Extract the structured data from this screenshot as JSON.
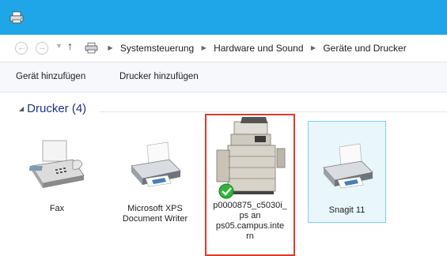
{
  "window": {
    "title_icon": "devices-printers-icon",
    "accent": "#1fa6e8"
  },
  "address": {
    "breadcrumb": [
      "Systemsteuerung",
      "Hardware und Sound",
      "Geräte und Drucker"
    ]
  },
  "commands": {
    "add_device": "Gerät hinzufügen",
    "add_printer": "Drucker hinzufügen"
  },
  "group": {
    "label": "Drucker (4)"
  },
  "printers": [
    {
      "label": "Fax"
    },
    {
      "label_lines": [
        "Microsoft XPS",
        "Document Writer"
      ]
    },
    {
      "label_lines": [
        "p0000875_c5030i_",
        "ps an",
        "ps05.campus.inte",
        "rn"
      ],
      "default": true
    },
    {
      "label": "Snagit 11"
    }
  ]
}
